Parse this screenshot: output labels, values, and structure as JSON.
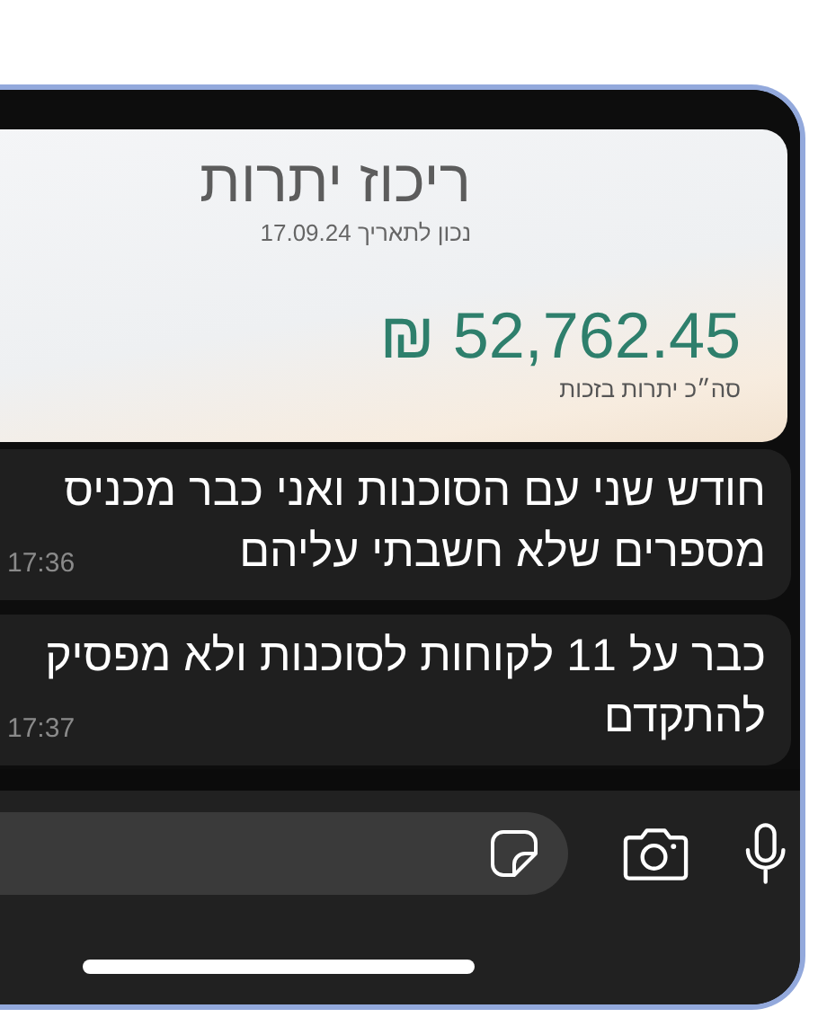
{
  "shared_image": {
    "title": "ריכוז יתרות",
    "date_line": "נכון לתאריך 17.09.24",
    "amount": "₪ 52,762.45",
    "amount_label": "סה״כ יתרות בזכות"
  },
  "messages": [
    {
      "lines": [
        "חודש שני עם הסוכנות ואני כבר מכניס",
        "מספרים שלא חשבתי עליהם"
      ],
      "time": "17:36"
    },
    {
      "lines": [
        "כבר על 11 לקוחות לסוכנות ולא מפסיק",
        "להתקדם"
      ],
      "time": "17:37"
    }
  ]
}
